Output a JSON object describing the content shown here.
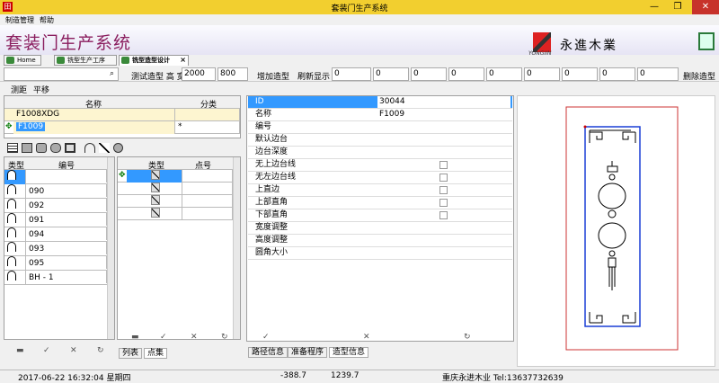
{
  "window": {
    "title": "套装门生产系统",
    "min": "—",
    "max": "❐",
    "close": "✕"
  },
  "menu": [
    "制造管理",
    "帮助"
  ],
  "banner": {
    "title": "套装门生产系统",
    "company": "永進木業",
    "logo_sub": "YONGJIN"
  },
  "tabs": [
    {
      "label": "Home"
    },
    {
      "label": "铣型生产工序"
    },
    {
      "label": "铣型造型设计"
    }
  ],
  "toolbar": {
    "search_btn": "⌕",
    "label1": "测试造型 高 宽",
    "h": "2000",
    "w": "800",
    "add": "增加造型",
    "refresh": "刷新显示",
    "zeros": [
      "0",
      "0",
      "0",
      "0",
      "0",
      "0",
      "0",
      "0",
      "0",
      "0"
    ],
    "del": "删除造型"
  },
  "subbar": {
    "measure": "测距",
    "translate": "平移"
  },
  "names_table": {
    "col_name": "名称",
    "col_cat": "分类",
    "rows": [
      {
        "name": "F1008XDG",
        "cat": ""
      },
      {
        "name": "F1009",
        "cat": "*"
      }
    ]
  },
  "type_table": {
    "col_type": "类型",
    "col_code": "编号",
    "rows": [
      "",
      "090",
      "092",
      "091",
      "094",
      "093",
      "095",
      "BH - 1"
    ]
  },
  "points_table": {
    "col_type": "类型",
    "col_pt": "点号"
  },
  "nav": {
    "first": "▬",
    "prev": "✓",
    "next": "✕",
    "last": "↻"
  },
  "left_tabs": [
    "列表",
    "点集"
  ],
  "props": [
    {
      "k": "ID",
      "v": "30044",
      "hl": true
    },
    {
      "k": "名称",
      "v": "F1009"
    },
    {
      "k": "编号",
      "v": ""
    },
    {
      "k": "默认边台",
      "v": ""
    },
    {
      "k": "边台深度",
      "v": ""
    },
    {
      "k": "无上边台线",
      "v": "",
      "cb": true
    },
    {
      "k": "无左边台线",
      "v": "",
      "cb": true
    },
    {
      "k": "上直边",
      "v": "",
      "cb": true
    },
    {
      "k": "上部直角",
      "v": "",
      "cb": true
    },
    {
      "k": "下部直角",
      "v": "",
      "cb": true
    },
    {
      "k": "宽度调整",
      "v": ""
    },
    {
      "k": "高度调整",
      "v": ""
    },
    {
      "k": "圆角大小",
      "v": ""
    }
  ],
  "prop_tabs": [
    "路径信息",
    "准备程序",
    "造型信息"
  ],
  "status": {
    "datetime": "2017-06-22 16:32:04 星期四",
    "x": "-388.7",
    "y": "1239.7",
    "company": "重庆永进木业 Tel:13637732639"
  },
  "colors": {
    "titlebar": "#f2cf2f",
    "title_text": "#8a1d5e",
    "highlight": "#3399ff"
  }
}
